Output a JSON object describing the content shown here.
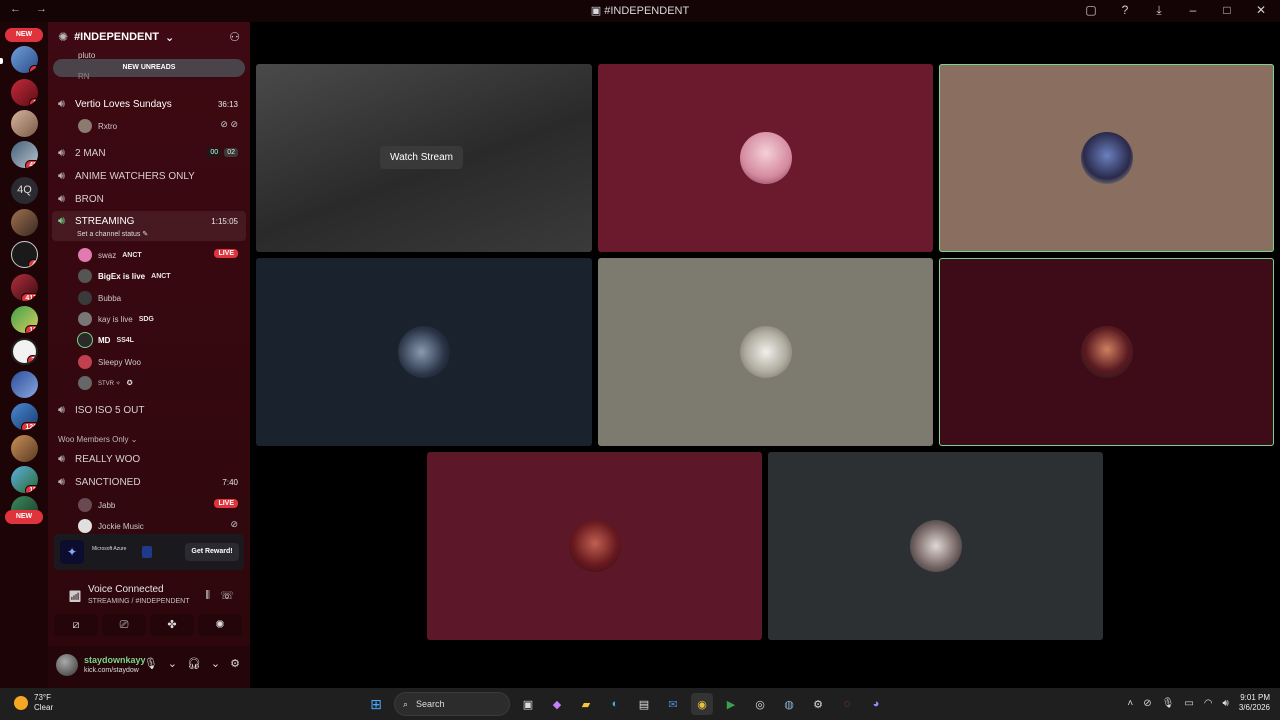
{
  "window": {
    "title": "#INDEPENDENT",
    "nav": "← →"
  },
  "guilds": {
    "top_pill": "NEW",
    "bottom_pill": "NEW",
    "text_server": "4Q",
    "badges": [
      "4",
      "1",
      "45",
      "4",
      "417",
      "18",
      "3",
      "126",
      "15",
      "4"
    ]
  },
  "server": {
    "name": "#INDEPENDENT",
    "new_unreads": "NEW UNREADS"
  },
  "channels": {
    "pluto": "pluto",
    "rn": "RN",
    "vertio": {
      "name": "Vertio Loves Sundays",
      "time": "36:13",
      "user": "Rxtro"
    },
    "two_man": {
      "name": "2 MAN",
      "time_a": "00",
      "time_b": "02"
    },
    "anime": "ANIME WATCHERS ONLY",
    "bron": "BRON",
    "streaming": {
      "name": "STREAMING",
      "time": "1:15:05",
      "status": "Set a channel status",
      "users": [
        {
          "name": "swaz",
          "tag": "ANCT",
          "live": "LIVE"
        },
        {
          "name": "BigEx is live",
          "tag": "ANCT"
        },
        {
          "name": "Bubba"
        },
        {
          "name": "kay is live",
          "tag": "SDG"
        },
        {
          "name": "MD",
          "tag": "SS4L"
        },
        {
          "name": "Sleepy Woo"
        },
        {
          "name": "STVR ✧",
          "tag": "✪"
        }
      ]
    },
    "iso": "ISO ISO 5 OUT",
    "category": "Woo Members Only",
    "really_woo": "REALLY WOO",
    "sanctioned": {
      "name": "SANCTIONED",
      "time": "7:40",
      "users": [
        {
          "name": "Jabb",
          "live": "LIVE"
        },
        {
          "name": "Jockie Music"
        }
      ]
    }
  },
  "promo": {
    "brand": "Microsoft Azure",
    "cta": "Get Reward!"
  },
  "voice": {
    "title": "Voice Connected",
    "subtitle": "STREAMING / #INDEPENDENT"
  },
  "user": {
    "name": "staydownkayy",
    "status": "kick.com/staydow"
  },
  "stage": {
    "watch_label": "Watch Stream"
  },
  "taskbar": {
    "temp": "73°F",
    "condition": "Clear",
    "search": "Search",
    "time": "9:01 PM",
    "date": "3/6/2026"
  },
  "colors": {
    "live": "#e0343c",
    "speaking": "#7ad38a",
    "sidebar": "#3e0912"
  }
}
